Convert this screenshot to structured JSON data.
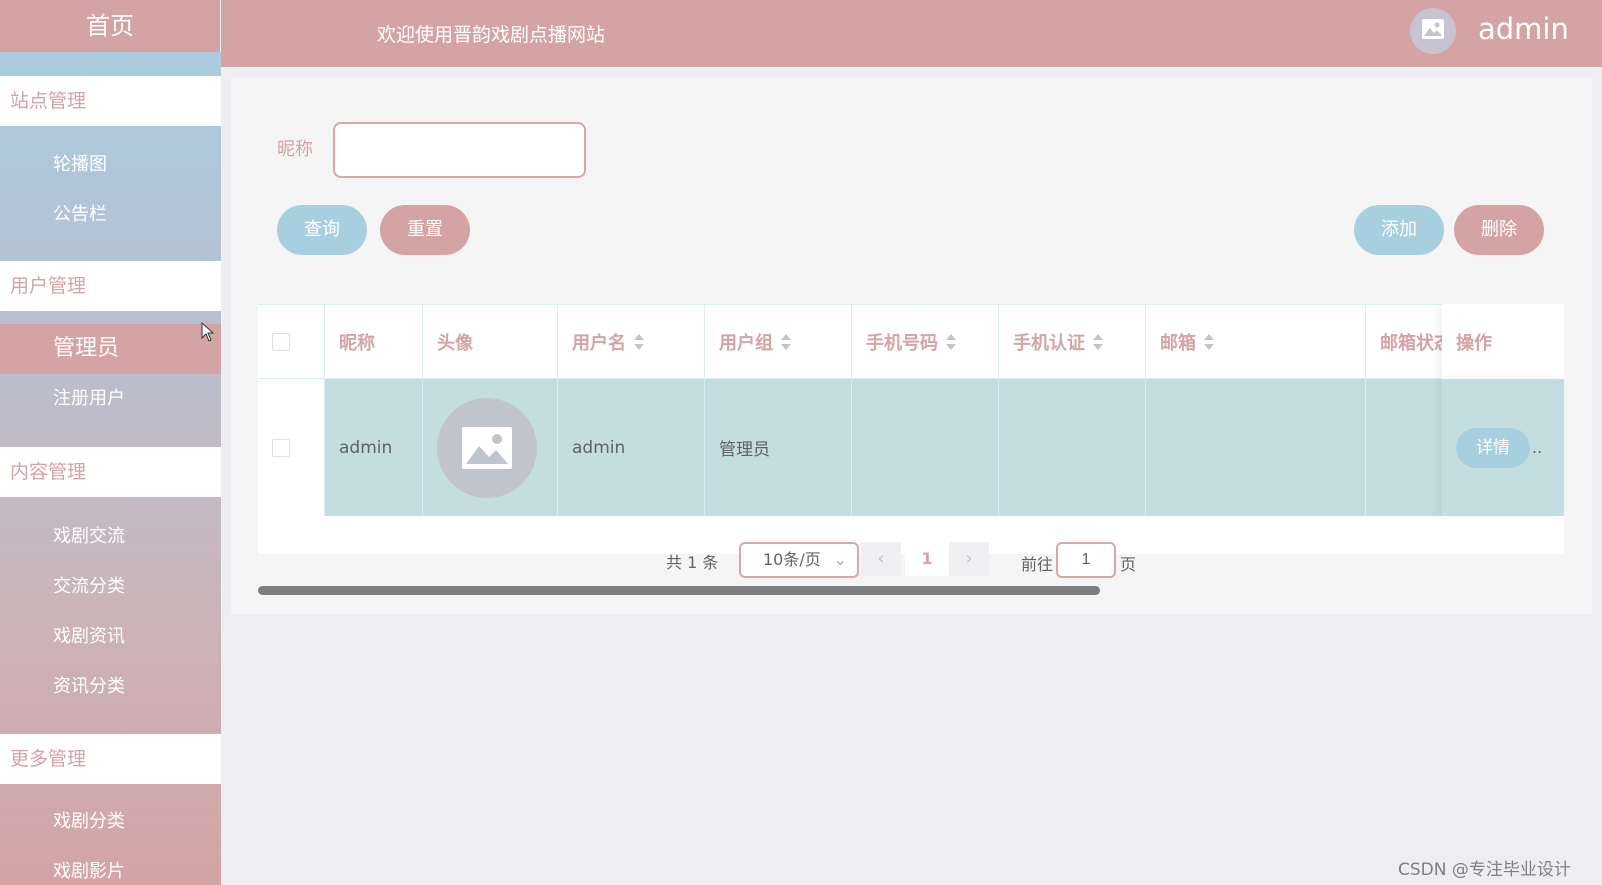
{
  "sidebar": {
    "home": "首页",
    "groups": [
      {
        "title": "站点管理",
        "items": [
          "轮播图",
          "公告栏"
        ]
      },
      {
        "title": "用户管理",
        "items": [
          "管理员",
          "注册用户"
        ]
      },
      {
        "title": "内容管理",
        "items": [
          "戏剧交流",
          "交流分类",
          "戏剧资讯",
          "资讯分类"
        ]
      },
      {
        "title": "更多管理",
        "items": [
          "戏剧分类",
          "戏剧影片"
        ]
      }
    ],
    "active_item": "管理员"
  },
  "header": {
    "title": "欢迎使用晋韵戏剧点播网站",
    "user": "admin",
    "avatar_icon": "image-icon"
  },
  "search": {
    "label": "昵称",
    "value": "",
    "query_label": "查询",
    "reset_label": "重置",
    "add_label": "添加",
    "delete_label": "删除"
  },
  "table": {
    "columns": [
      "昵称",
      "头像",
      "用户名",
      "用户组",
      "手机号码",
      "手机认证",
      "邮箱",
      "邮箱状态",
      "操作"
    ],
    "rows": [
      {
        "nickname": "admin",
        "avatar": "image-icon",
        "username": "admin",
        "group": "管理员",
        "phone": "",
        "phone_verified": "",
        "email": "",
        "email_status": "",
        "action": "详情"
      }
    ]
  },
  "pagination": {
    "total": "共 1 条",
    "page_size": "10条/页",
    "prev": "‹",
    "current": "1",
    "next": "›",
    "goto_label": "前往",
    "goto_value": "1",
    "page_label": "页"
  },
  "watermark": "CSDN @专注毕业设计",
  "colors": {
    "primary": "#d4a4a5",
    "accent": "#a8cfe0",
    "row": "#c4dde1"
  }
}
